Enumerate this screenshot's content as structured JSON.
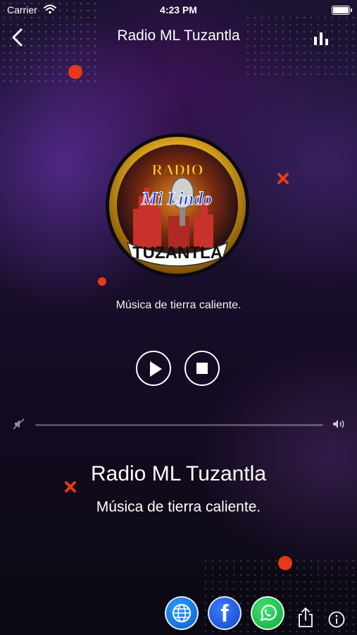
{
  "status_bar": {
    "carrier": "Carrier",
    "time": "4:23 PM"
  },
  "nav": {
    "title": "Radio ML Tuzantla",
    "back_icon": "chevron-left-icon",
    "right_icon": "stats-bars-icon"
  },
  "logo": {
    "top_text": "RADIO",
    "script_text": "Mi Lindo",
    "bottom_text": "TUZANTLA",
    "colors": {
      "ring": "#d9a21c",
      "inner": "#1a1a2e",
      "banner": "#ffffff"
    }
  },
  "station": {
    "logo_subtitle": "Música de tierra caliente.",
    "title": "Radio ML Tuzantla",
    "subtitle": "Música de tierra caliente."
  },
  "controls": {
    "play_icon": "play-icon",
    "stop_icon": "stop-icon"
  },
  "volume": {
    "min_icon": "speaker-mute-icon",
    "max_icon": "speaker-loud-icon",
    "level": 0
  },
  "footer": {
    "buttons": [
      {
        "name": "web",
        "icon": "globe-icon"
      },
      {
        "name": "facebook",
        "icon": "facebook-icon",
        "label": "f"
      },
      {
        "name": "whatsapp",
        "icon": "whatsapp-icon"
      },
      {
        "name": "share",
        "icon": "share-icon"
      },
      {
        "name": "info",
        "icon": "info-icon"
      }
    ]
  },
  "colors": {
    "accent": "#e6391b",
    "background_top": "#1a1230",
    "background_bottom": "#0b0912"
  }
}
